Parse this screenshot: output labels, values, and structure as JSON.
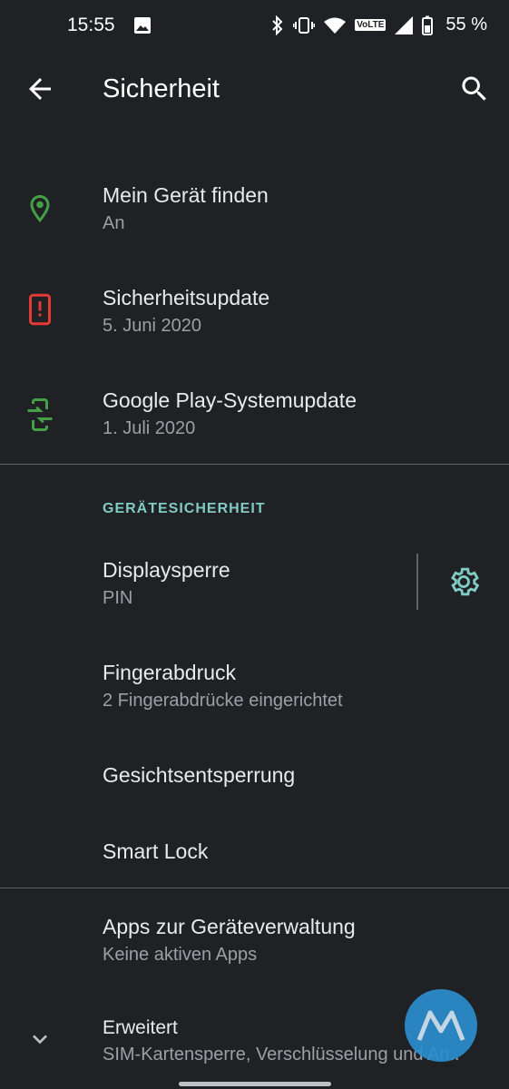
{
  "status_bar": {
    "time": "15:55",
    "network": "VoLTE",
    "battery": "55 %"
  },
  "app_bar": {
    "title": "Sicherheit"
  },
  "items_top": [
    {
      "title": "Mein Gerät finden",
      "summary": "An",
      "icon": "location-pin-icon",
      "icon_color": "#43a047"
    },
    {
      "title": "Sicherheitsupdate",
      "summary": "5. Juni 2020",
      "icon": "phone-alert-icon",
      "icon_color": "#e53935"
    },
    {
      "title": "Google Play-Systemupdate",
      "summary": "1. Juli 2020",
      "icon": "phone-update-icon",
      "icon_color": "#43a047"
    }
  ],
  "device_security": {
    "header": "GERÄTESICHERHEIT",
    "items": [
      {
        "title": "Displaysperre",
        "summary": "PIN"
      },
      {
        "title": "Fingerabdruck",
        "summary": "2 Fingerabdrücke eingerichtet"
      },
      {
        "title": "Gesichtsentsperrung"
      },
      {
        "title": "Smart Lock"
      }
    ]
  },
  "items_bottom": [
    {
      "title": "Apps zur Geräteverwaltung",
      "summary": "Keine aktiven Apps"
    },
    {
      "title": "Erweitert",
      "summary": "SIM-Kartensperre, Verschlüsselung und An..",
      "icon": "chevron-down-icon"
    }
  ],
  "colors": {
    "background": "#202124",
    "accent": "#80cbc4",
    "divider": "#5f6368"
  }
}
